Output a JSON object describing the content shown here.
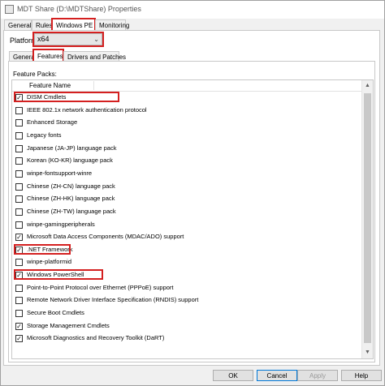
{
  "window": {
    "title": "MDT Share (D:\\MDTShare) Properties"
  },
  "tabs": [
    "General",
    "Rules",
    "Windows PE",
    "Monitoring"
  ],
  "platform": {
    "label": "Platform",
    "value": "x64"
  },
  "subtabs": [
    "General",
    "Features",
    "Drivers and Patches"
  ],
  "feature_packs": {
    "label": "Feature Packs:",
    "column_header": "Feature Name",
    "items": [
      {
        "label": "DISM Cmdlets",
        "checked": true
      },
      {
        "label": "IEEE 802.1x network authentication protocol",
        "checked": false
      },
      {
        "label": "Enhanced Storage",
        "checked": false
      },
      {
        "label": "Legacy fonts",
        "checked": false
      },
      {
        "label": "Japanese (JA-JP) language pack",
        "checked": false
      },
      {
        "label": "Korean (KO-KR) language pack",
        "checked": false
      },
      {
        "label": "winpe-fontsupport-winre",
        "checked": false
      },
      {
        "label": "Chinese (ZH-CN) language pack",
        "checked": false
      },
      {
        "label": "Chinese (ZH-HK) language pack",
        "checked": false
      },
      {
        "label": "Chinese (ZH-TW) language pack",
        "checked": false
      },
      {
        "label": "winpe-gamingperipherals",
        "checked": false
      },
      {
        "label": "Microsoft Data Access Components (MDAC/ADO) support",
        "checked": true
      },
      {
        "label": ".NET Framework",
        "checked": true
      },
      {
        "label": "winpe-platformid",
        "checked": false
      },
      {
        "label": "Windows PowerShell",
        "checked": true
      },
      {
        "label": "Point-to-Point Protocol over Ethernet (PPPoE) support",
        "checked": false
      },
      {
        "label": "Remote Network Driver Interface Specification (RNDIS) support",
        "checked": false
      },
      {
        "label": "Secure Boot Cmdlets",
        "checked": false
      },
      {
        "label": "Storage Management Cmdlets",
        "checked": true
      },
      {
        "label": "Microsoft Diagnostics and Recovery Toolkit (DaRT)",
        "checked": true
      }
    ]
  },
  "buttons": {
    "ok": "OK",
    "cancel": "Cancel",
    "apply": "Apply",
    "help": "Help"
  },
  "colors": {
    "highlight": "#d42020",
    "primary_border": "#0078d7"
  }
}
